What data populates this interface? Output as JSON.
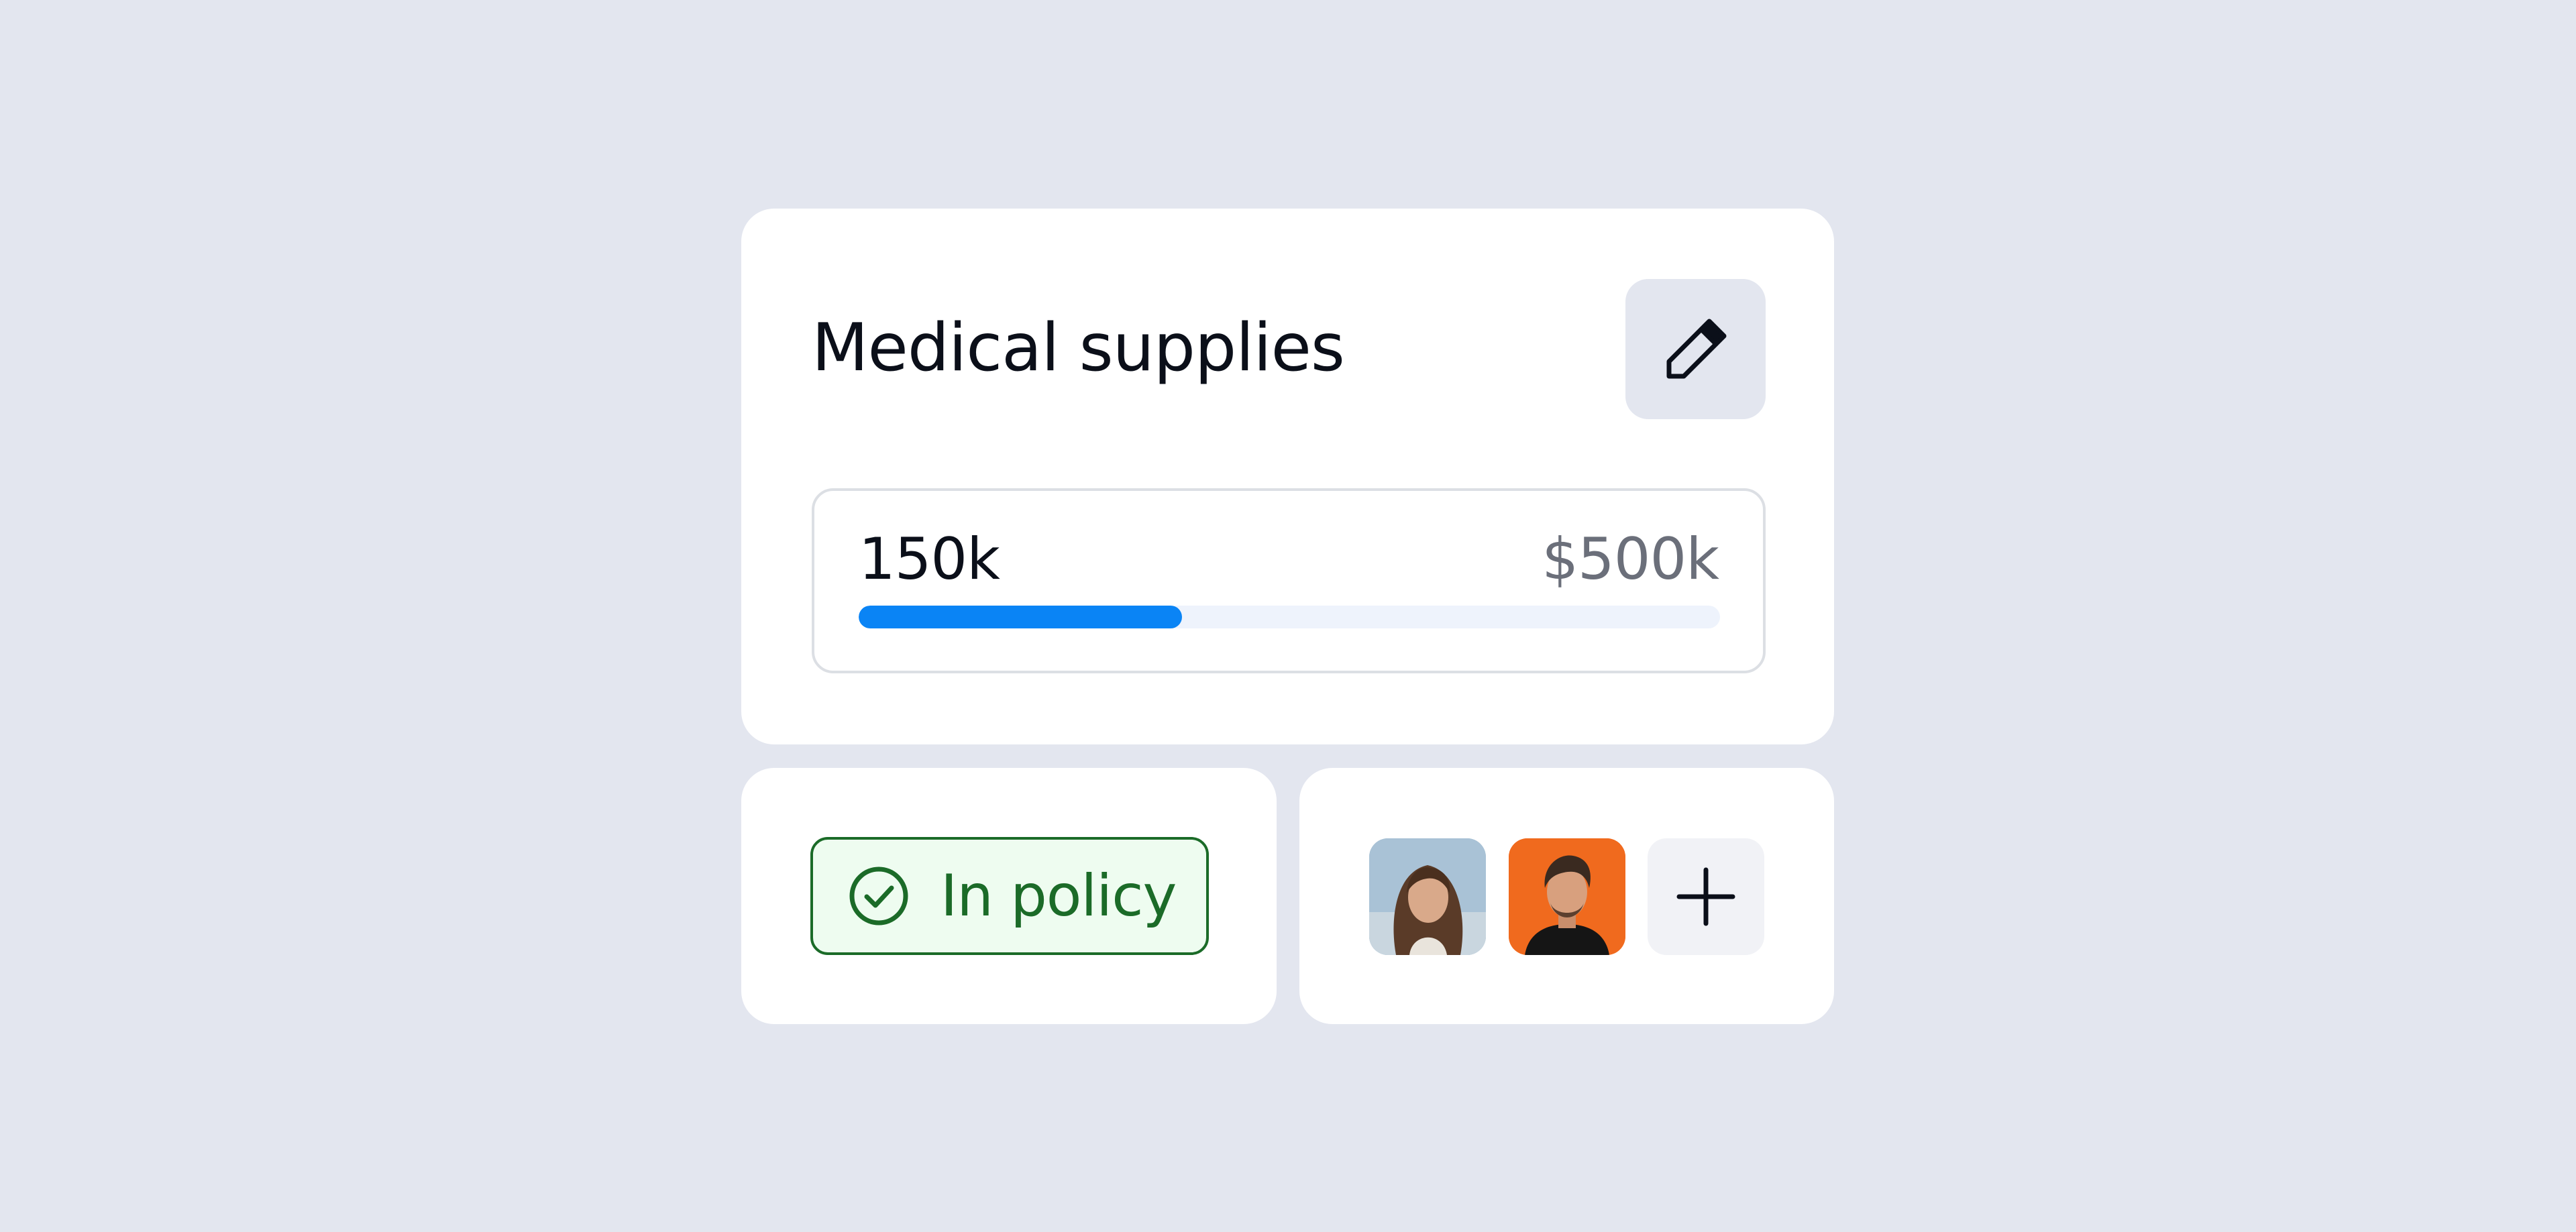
{
  "budget_card": {
    "title": "Medical supplies",
    "edit_icon": "pencil-icon",
    "spent_label": "150k",
    "total_label": "$500k",
    "progress_fraction": 0.375,
    "progress_color": "#0a84f5"
  },
  "policy_card": {
    "status_label": "In policy",
    "status_icon": "check-circle-icon",
    "status_color": "#1b6b28"
  },
  "people_card": {
    "avatars": [
      {
        "name": "woman-avatar"
      },
      {
        "name": "man-avatar"
      }
    ],
    "add_icon": "plus-icon"
  }
}
